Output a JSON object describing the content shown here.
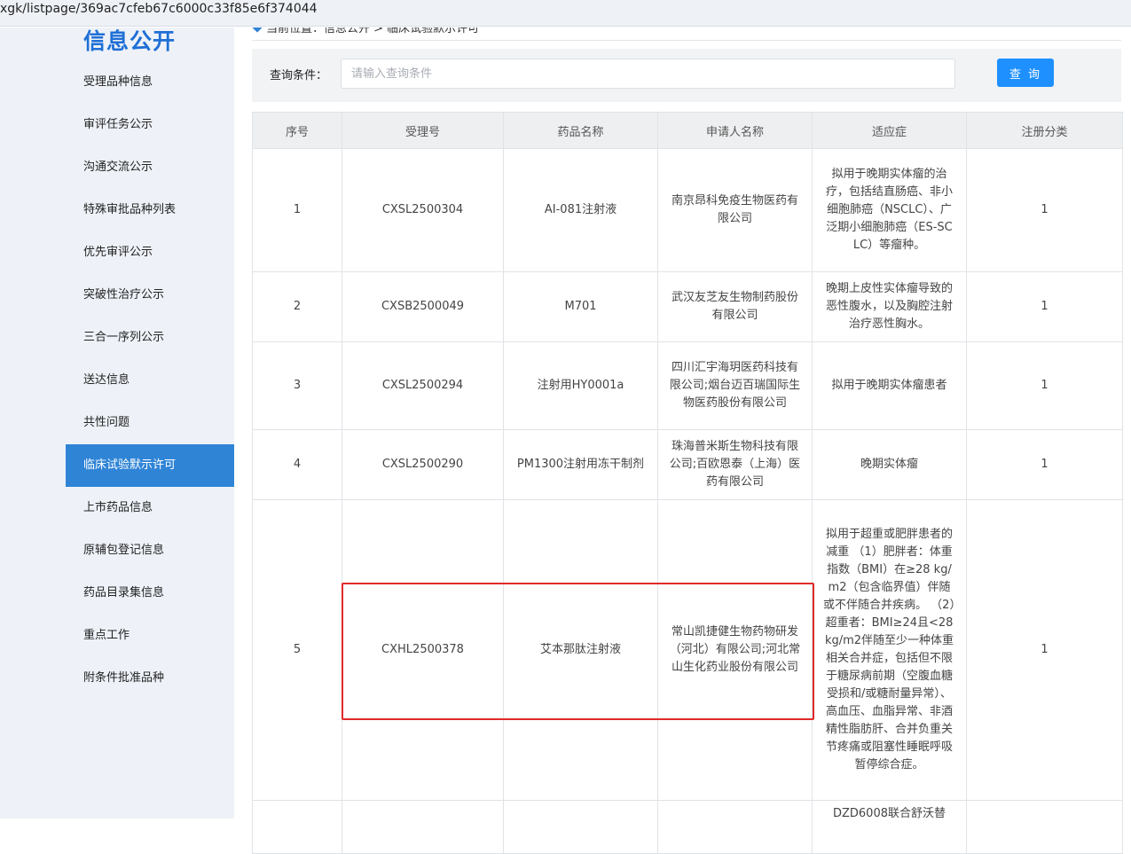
{
  "browser": {
    "url": "xgk/listpage/369ac7cfeb67c6000c33f85e6f374044"
  },
  "sidebar": {
    "title": "信息公开",
    "items": [
      {
        "label": "受理品种信息"
      },
      {
        "label": "审评任务公示"
      },
      {
        "label": "沟通交流公示"
      },
      {
        "label": "特殊审批品种列表"
      },
      {
        "label": "优先审评公示"
      },
      {
        "label": "突破性治疗公示"
      },
      {
        "label": "三合一序列公示"
      },
      {
        "label": "送达信息"
      },
      {
        "label": "共性问题"
      },
      {
        "label": "临床试验默示许可"
      },
      {
        "label": "上市药品信息"
      },
      {
        "label": "原辅包登记信息"
      },
      {
        "label": "药品目录集信息"
      },
      {
        "label": "重点工作"
      },
      {
        "label": "附条件批准品种"
      }
    ],
    "active_item": "临床试验默示许可"
  },
  "breadcrumb": {
    "text": "当前位置：信息公开 > 临床试验默示许可"
  },
  "search": {
    "label": "查询条件：",
    "placeholder": "请输入查询条件",
    "button_label": "查 询"
  },
  "table": {
    "headers": [
      "序号",
      "受理号",
      "药品名称",
      "申请人名称",
      "适应症",
      "注册分类"
    ],
    "rows": [
      {
        "index": "1",
        "accept_no": "CXSL2500304",
        "drug": "AI-081注射液",
        "applicant": "南京昂科免疫生物医药有限公司",
        "indication": "拟用于晚期实体瘤的治疗，包括结直肠癌、非小细胞肺癌（NSCLC）、广泛期小细胞肺癌（ES-SCLC）等瘤种。",
        "category": "1"
      },
      {
        "index": "2",
        "accept_no": "CXSB2500049",
        "drug": "M701",
        "applicant": "武汉友芝友生物制药股份有限公司",
        "indication": "晚期上皮性实体瘤导致的恶性腹水，以及胸腔注射治疗恶性胸水。",
        "category": "1"
      },
      {
        "index": "3",
        "accept_no": "CXSL2500294",
        "drug": "注射用HY0001a",
        "applicant": "四川汇宇海玥医药科技有限公司;烟台迈百瑞国际生物医药股份有限公司",
        "indication": "拟用于晚期实体瘤患者",
        "category": "1"
      },
      {
        "index": "4",
        "accept_no": "CXSL2500290",
        "drug": "PM1300注射用冻干制剂",
        "applicant": "珠海普米斯生物科技有限公司;百欧恩泰（上海）医药有限公司",
        "indication": "晚期实体瘤",
        "category": "1"
      },
      {
        "index": "5",
        "accept_no": "CXHL2500378",
        "drug": "艾本那肽注射液",
        "applicant": "常山凯捷健生物药物研发（河北）有限公司;河北常山生化药业股份有限公司",
        "indication": "拟用于超重或肥胖患者的减重 （1）肥胖者：体重指数（BMI）在≥28 kg/m2（包含临界值）伴随或不伴随合并疾病。 （2）超重者：BMI≥24且<28 kg/m2伴随至少一种体重相关合并症，包括但不限于糖尿病前期（空腹血糖受损和/或糖耐量异常）、高血压、血脂异常、非酒精性脂肪肝、合并负重关节疼痛或阻塞性睡眠呼吸暂停综合症。",
        "category": "1"
      },
      {
        "index": "",
        "accept_no": "",
        "drug": "",
        "applicant": "",
        "indication": "DZD6008联合舒沃替",
        "category": ""
      }
    ]
  },
  "annotation": {
    "color": "#e02a2a"
  }
}
